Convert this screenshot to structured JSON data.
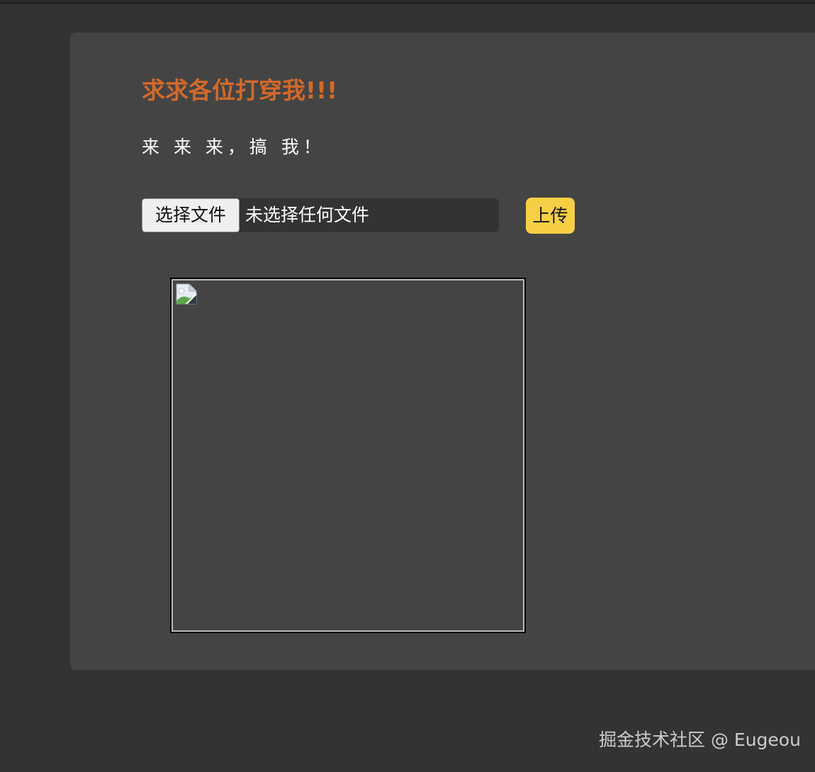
{
  "header": {
    "title": "求求各位打穿我!!!",
    "subtitle": "来 来 来，搞 我！"
  },
  "upload_form": {
    "choose_button_label": "选择文件",
    "file_status": "未选择任何文件",
    "upload_button_label": "上传"
  },
  "preview": {
    "icon": "broken-image-icon"
  },
  "footer": {
    "watermark": "掘金技术社区 @ Eugeou"
  },
  "colors": {
    "page_background": "#333333",
    "card_background": "#444444",
    "title_color": "#d2692a",
    "upload_button": "#f6cf45"
  }
}
